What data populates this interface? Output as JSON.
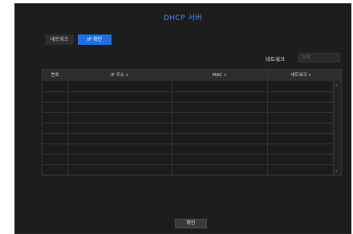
{
  "dialog": {
    "title": "DHCP 서버"
  },
  "tabs": [
    {
      "label": "네트워크",
      "active": false
    },
    {
      "label": "IP 확인",
      "active": true
    }
  ],
  "filter": {
    "label": "네트워크",
    "selected": "전체"
  },
  "table": {
    "columns": [
      "번호",
      "IP 주소",
      "MAC",
      "네트워크"
    ],
    "rows": []
  },
  "footer": {
    "ok_label": "확인"
  },
  "colors": {
    "accent": "#1f6fe5",
    "title": "#3d8fff",
    "background": "#1d1d1d"
  }
}
